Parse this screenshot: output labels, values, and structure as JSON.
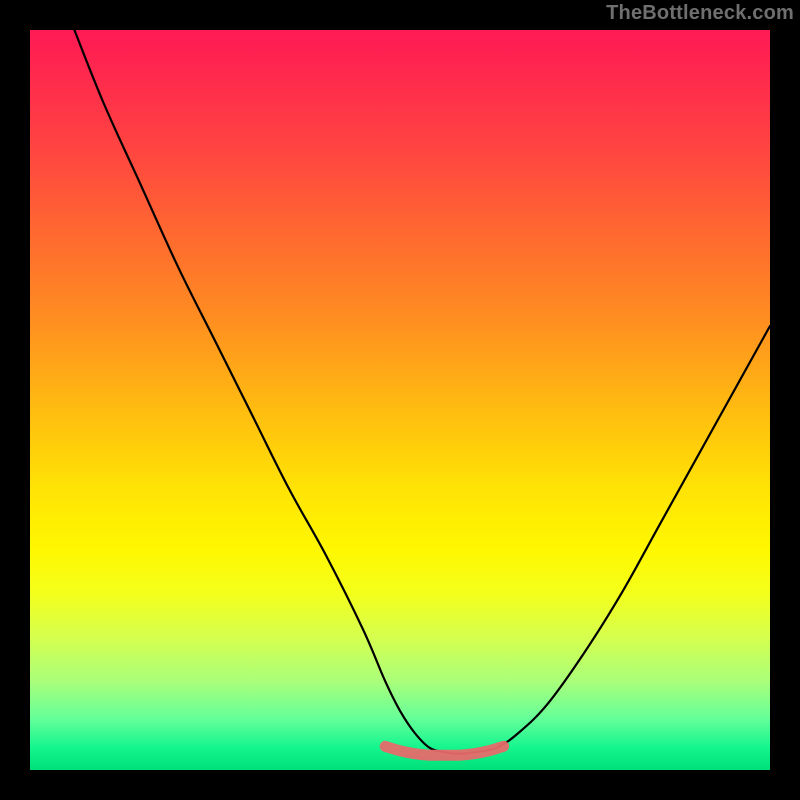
{
  "watermark": "TheBottleneck.com",
  "chart_data": {
    "type": "line",
    "title": "",
    "xlabel": "",
    "ylabel": "",
    "xlim": [
      0,
      100
    ],
    "ylim": [
      0,
      100
    ],
    "grid": false,
    "legend": false,
    "series": [
      {
        "name": "curve",
        "color": "#000000",
        "x": [
          6,
          10,
          15,
          20,
          25,
          30,
          35,
          40,
          45,
          48,
          50,
          52,
          54,
          56,
          58,
          60,
          63,
          66,
          70,
          75,
          80,
          85,
          90,
          95,
          100
        ],
        "y": [
          100,
          90,
          79,
          68,
          58,
          48,
          38,
          29,
          19,
          12,
          8,
          5,
          3,
          2.4,
          2.2,
          2.4,
          3,
          5,
          9,
          16,
          24,
          33,
          42,
          51,
          60
        ]
      },
      {
        "name": "bottom-marker",
        "color": "#e76a6a",
        "x": [
          48,
          50,
          52,
          54,
          56,
          58,
          60,
          62,
          64
        ],
        "y": [
          3.2,
          2.6,
          2.2,
          2.0,
          2.0,
          2.0,
          2.2,
          2.6,
          3.2
        ]
      }
    ],
    "gradient_stops": [
      {
        "pos": 0,
        "color": "#ff1a55"
      },
      {
        "pos": 8,
        "color": "#ff2e4b"
      },
      {
        "pos": 18,
        "color": "#ff4a3e"
      },
      {
        "pos": 28,
        "color": "#ff6a2f"
      },
      {
        "pos": 38,
        "color": "#ff8a22"
      },
      {
        "pos": 46,
        "color": "#ffa817"
      },
      {
        "pos": 54,
        "color": "#ffc60d"
      },
      {
        "pos": 62,
        "color": "#ffe305"
      },
      {
        "pos": 70,
        "color": "#fff700"
      },
      {
        "pos": 76,
        "color": "#f4ff1a"
      },
      {
        "pos": 82,
        "color": "#d6ff4e"
      },
      {
        "pos": 88,
        "color": "#aaff7a"
      },
      {
        "pos": 93,
        "color": "#66ff99"
      },
      {
        "pos": 97,
        "color": "#14f58e"
      },
      {
        "pos": 100,
        "color": "#00e07a"
      }
    ]
  }
}
